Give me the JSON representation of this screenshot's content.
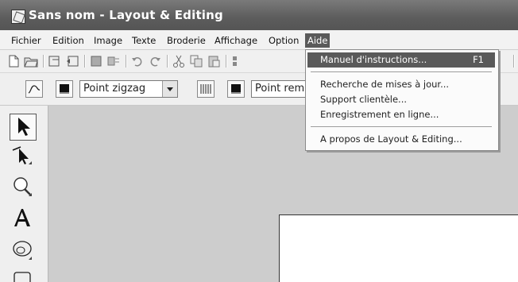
{
  "window": {
    "title": "Sans nom - Layout & Editing",
    "app_icon": "layout-editing-app-icon"
  },
  "menubar": {
    "items": [
      {
        "label": "Fichier"
      },
      {
        "label": "Edition"
      },
      {
        "label": "Image"
      },
      {
        "label": "Texte"
      },
      {
        "label": "Broderie"
      },
      {
        "label": "Affichage"
      },
      {
        "label": "Option"
      },
      {
        "label": "Aide",
        "active": true
      }
    ]
  },
  "toolbar2": {
    "stitch_combo_1": {
      "value": "Point zigzag"
    },
    "stitch_combo_2": {
      "value": "Point rem"
    }
  },
  "aide_menu": {
    "items": [
      {
        "label": "Manuel d'instructions...",
        "shortcut": "F1",
        "highlighted": true
      },
      {
        "label": "Recherche de mises à jour..."
      },
      {
        "label": "Support clientèle..."
      },
      {
        "label": "Enregistrement en ligne..."
      },
      {
        "label": "A propos de Layout & Editing..."
      }
    ]
  },
  "colors": {
    "menu_highlight": "#5a5a5a",
    "canvas": "#cdcdcd",
    "paper": "#ffffff"
  }
}
